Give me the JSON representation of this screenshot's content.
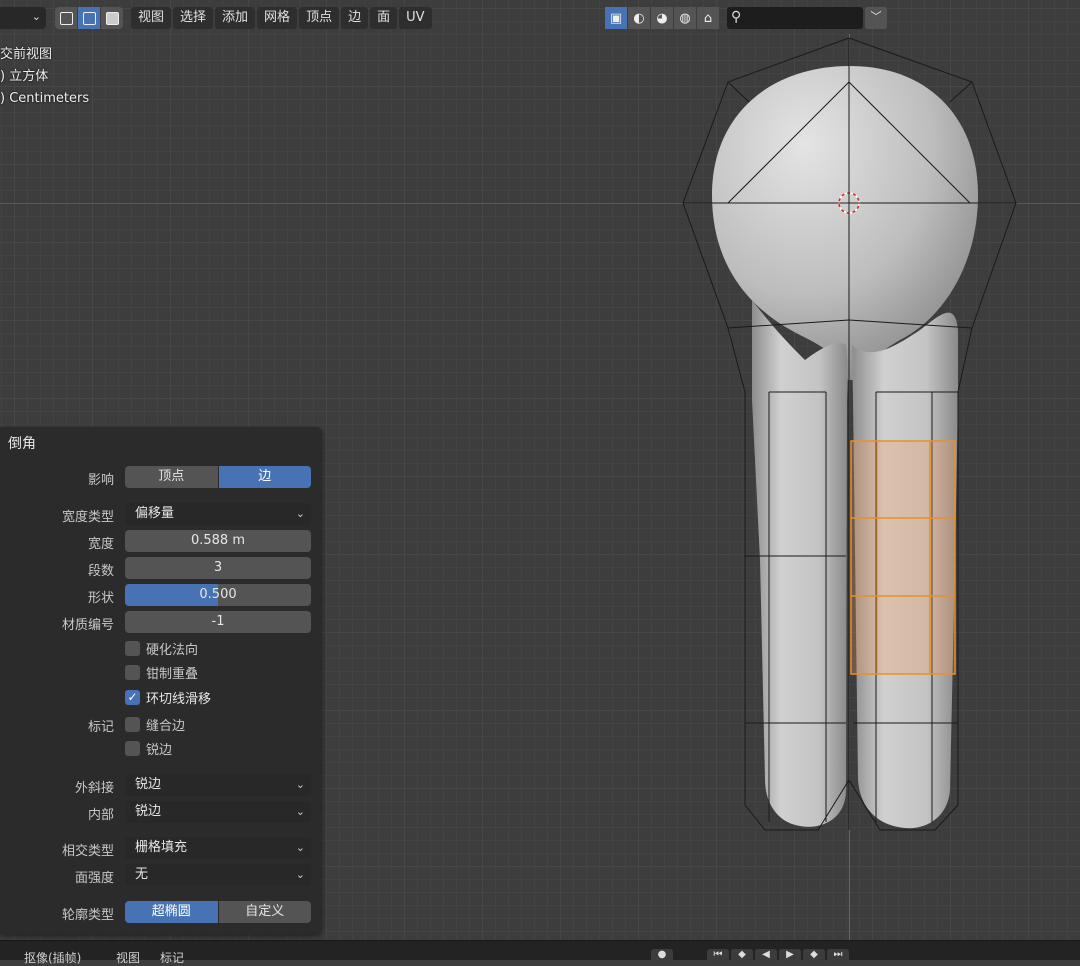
{
  "header": {
    "menu": [
      "视图",
      "选择",
      "添加",
      "网格",
      "顶点",
      "边",
      "面",
      "UV"
    ],
    "select_modes": [
      "vertex-select",
      "edge-select",
      "face-select"
    ],
    "active_select_mode": "edge-select",
    "shading_icons": [
      "overlay-icon",
      "solid-shading-icon",
      "material-shading-icon",
      "rendered-shading-icon",
      "brush-icon"
    ],
    "accent_color": "#4772b3"
  },
  "overlay": {
    "view_name": "交前视图",
    "object_name": ") 立方体",
    "units": ") Centimeters"
  },
  "panel": {
    "title": "倒角",
    "affect": {
      "label": "影响",
      "options": [
        "顶点",
        "边"
      ],
      "selected": "边"
    },
    "width_type": {
      "label": "宽度类型",
      "value": "偏移量"
    },
    "width": {
      "label": "宽度",
      "value": "0.588 m"
    },
    "segments": {
      "label": "段数",
      "value": "3"
    },
    "shape": {
      "label": "形状",
      "value": "0.500",
      "fraction": 0.5
    },
    "material_index": {
      "label": "材质编号",
      "value": "-1"
    },
    "harden_normals": {
      "label": "硬化法向",
      "checked": false
    },
    "clamp_overlap": {
      "label": "钳制重叠",
      "checked": false
    },
    "loop_slide": {
      "label": "环切线滑移",
      "checked": true
    },
    "mark": {
      "label": "标记",
      "seams_label": "缝合边",
      "seams": false,
      "sharp_label": "锐边",
      "sharp": false
    },
    "miter_outer": {
      "label": "外斜接",
      "value": "锐边"
    },
    "miter_inner": {
      "label": "内部",
      "value": "锐边"
    },
    "intersection_type": {
      "label": "相交类型",
      "value": "栅格填充"
    },
    "face_strength": {
      "label": "面强度",
      "value": "无"
    },
    "profile_type": {
      "label": "轮廓类型",
      "options": [
        "超椭圆",
        "自定义"
      ],
      "selected": "超椭圆"
    }
  },
  "bottom": {
    "keying": "抠像(插帧)",
    "view": "视图",
    "marker": "标记"
  }
}
